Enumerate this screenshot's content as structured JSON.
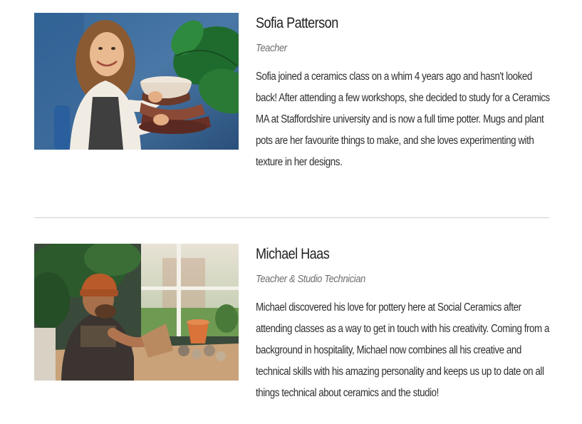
{
  "team": [
    {
      "name": "Sofia Patterson",
      "role": "Teacher",
      "bio": "Sofia joined a ceramics class on a whim 4 years ago and hasn't looked back! After attending a few workshops, she decided to study for a Ceramics MA at Staffordshire university and is now a full time potter. Mugs and plant pots are her favourite things to make, and she loves experimenting with texture in her designs."
    },
    {
      "name": "Michael Haas",
      "role": "Teacher & Studio Technician",
      "bio": "Michael discovered his love for pottery here at Social Ceramics after attending classes as a way to get in touch with his creativity. Coming from a background in hospitality, Michael now combines all his creative and technical skills with his amazing personality and keeps us up to date on all things technical about ceramics and the studio!"
    }
  ],
  "colors": {
    "text": "#2b2b2b",
    "role": "#6e6e6e",
    "divider": "#cfcfcf"
  }
}
